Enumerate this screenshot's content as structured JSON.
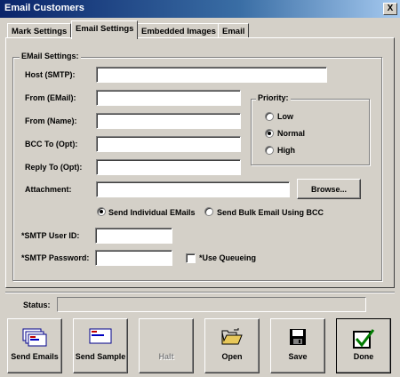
{
  "window": {
    "title": "Email Customers",
    "close_glyph": "X"
  },
  "tabs": [
    {
      "label": "Mark Settings"
    },
    {
      "label": "Email Settings"
    },
    {
      "label": "Embedded Images"
    },
    {
      "label": "Email"
    }
  ],
  "email_settings": {
    "group_label": "EMail Settings:",
    "host_label": "Host (SMTP):",
    "host_value": "",
    "from_email_label": "From (EMail):",
    "from_email_value": "",
    "from_name_label": "From (Name):",
    "from_name_value": "",
    "bcc_label": "BCC To (Opt):",
    "bcc_value": "",
    "reply_label": "Reply To (Opt):",
    "reply_value": "",
    "attachment_label": "Attachment:",
    "attachment_value": "",
    "browse_label": "Browse...",
    "send_individual_label": "Send Individual EMails",
    "send_bulk_label": "Send Bulk Email Using BCC",
    "smtp_user_label": "*SMTP User ID:",
    "smtp_user_value": "",
    "smtp_password_label": "*SMTP Password:",
    "smtp_password_value": "",
    "use_queueing_label": "*Use Queueing"
  },
  "priority": {
    "label": "Priority:",
    "options": [
      "Low",
      "Normal",
      "High"
    ],
    "selected": "Normal"
  },
  "status": {
    "label": "Status:",
    "value": ""
  },
  "buttons": {
    "send_emails": "Send Emails",
    "send_sample": "Send Sample",
    "halt": "Halt",
    "open": "Open",
    "save": "Save",
    "done": "Done"
  },
  "icons": {
    "send_emails": "envelope-stack-icon",
    "send_sample": "envelope-icon",
    "open": "open-folder-icon",
    "save": "floppy-disk-icon",
    "done": "checkbox-check-icon"
  }
}
